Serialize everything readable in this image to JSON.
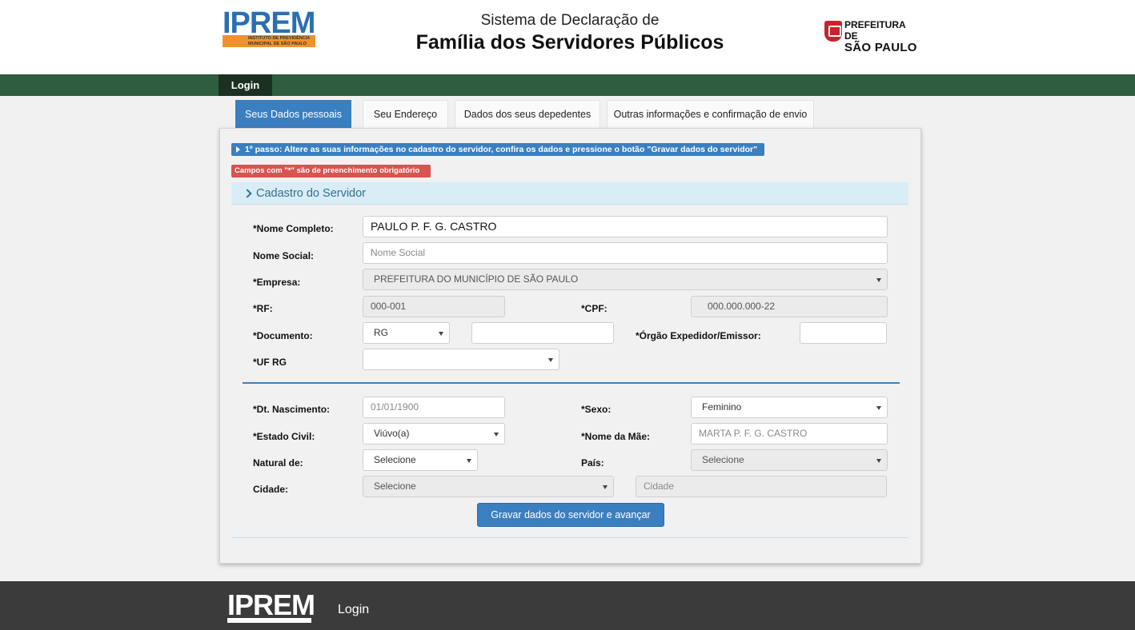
{
  "header": {
    "logo_text": "IPREM",
    "logo_subtitle_1": "INSTITUTO DE PREVIDÊNCIA",
    "logo_subtitle_2": "MUNICIPAL DE SÃO PAULO",
    "title_line1": "Sistema de Declaração de",
    "title_line2": "Família dos Servidores Públicos",
    "prefeitura_line1": "PREFEITURA DE",
    "prefeitura_line2": "SÃO PAULO"
  },
  "navbar": {
    "login_label": "Login"
  },
  "tabs": [
    {
      "label": "Seus Dados pessoais",
      "active": true
    },
    {
      "label": "Seu Endereço",
      "active": false
    },
    {
      "label": "Dados dos seus depedentes",
      "active": false
    },
    {
      "label": "Outras informações e confirmação de envio",
      "active": false
    }
  ],
  "panel": {
    "step_badge": "1º passo: Altere as suas informações no cadastro do servidor, confira os dados e pressione o botão \"Gravar dados do servidor\"",
    "required_badge": "Campos com \"*\" são de preenchimento obrigatório",
    "section_title": "Cadastro do Servidor"
  },
  "form": {
    "nome_completo": {
      "label": "*Nome Completo:",
      "value": "PAULO P. F. G. CASTRO"
    },
    "nome_social": {
      "label": "Nome Social:",
      "placeholder": "Nome Social"
    },
    "empresa": {
      "label": "*Empresa:",
      "value": "PREFEITURA DO MUNICÍPIO DE SÃO PAULO"
    },
    "rf": {
      "label": "*RF:",
      "value": "000-001"
    },
    "cpf": {
      "label": "*CPF:",
      "value": "000.000.000-22"
    },
    "documento": {
      "label": "*Documento:",
      "type_value": "RG",
      "number_value": ""
    },
    "orgao": {
      "label": "*Órgão Expedidor/Emissor:",
      "value": ""
    },
    "uf_rg": {
      "label": "*UF RG",
      "value": ""
    },
    "dt_nascimento": {
      "label": "*Dt. Nascimento:",
      "placeholder": "01/01/1900"
    },
    "sexo": {
      "label": "*Sexo:",
      "value": "Feminino"
    },
    "estado_civil": {
      "label": "*Estado Civil:",
      "value": "Viúvo(a)"
    },
    "nome_mae": {
      "label": "*Nome da Mãe:",
      "value": "MARTA P. F. G. CASTRO"
    },
    "natural_de": {
      "label": "Natural de:",
      "value": "Selecione"
    },
    "pais": {
      "label": "País:",
      "value": "Selecione"
    },
    "cidade": {
      "label": "Cidade:",
      "select_value": "Selecione",
      "placeholder": "Cidade"
    },
    "save_button": "Gravar dados do servidor e avançar"
  },
  "footer": {
    "logo_text": "IPREM",
    "login_label": "Login"
  },
  "colors": {
    "brand_blue": "#3a7fc0",
    "nav_green": "#2e5e3f",
    "danger_red": "#d9534f",
    "footer_gray": "#3b3b3b"
  }
}
